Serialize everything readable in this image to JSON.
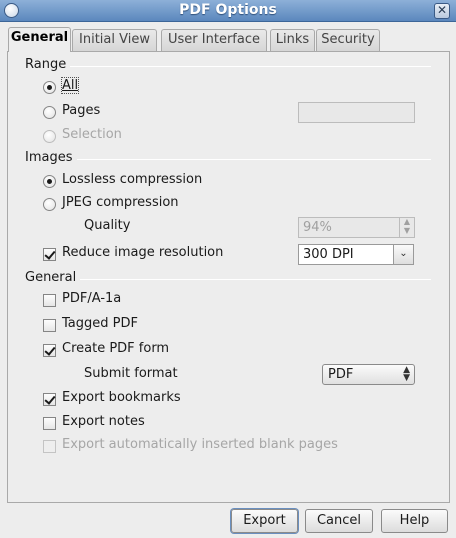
{
  "window": {
    "title": "PDF Options"
  },
  "tabs": [
    "General",
    "Initial View",
    "User Interface",
    "Links",
    "Security"
  ],
  "range": {
    "heading": "Range",
    "options": [
      "All",
      "Pages",
      "Selection"
    ],
    "selected": "All",
    "pages_value": ""
  },
  "images": {
    "heading": "Images",
    "lossless_label": "Lossless compression",
    "jpeg_label": "JPEG compression",
    "selected": "Lossless compression",
    "quality_label": "Quality",
    "quality_value": "94%",
    "reduce_label": "Reduce image resolution",
    "reduce_checked": true,
    "resolution_value": "300 DPI"
  },
  "general": {
    "heading": "General",
    "pdfa_label": "PDF/A-1a",
    "tagged_label": "Tagged PDF",
    "form_label": "Create PDF form",
    "submit_label": "Submit format",
    "submit_value": "PDF",
    "bookmarks_label": "Export bookmarks",
    "notes_label": "Export notes",
    "blank_label": "Export automatically inserted blank pages"
  },
  "buttons": {
    "export": "Export",
    "cancel": "Cancel",
    "help": "Help"
  },
  "colors": {
    "titlebar": "#5b87bd",
    "background": "#ededed"
  },
  "icons": {
    "window_menu": "window-menu-icon",
    "close": "close-icon"
  }
}
